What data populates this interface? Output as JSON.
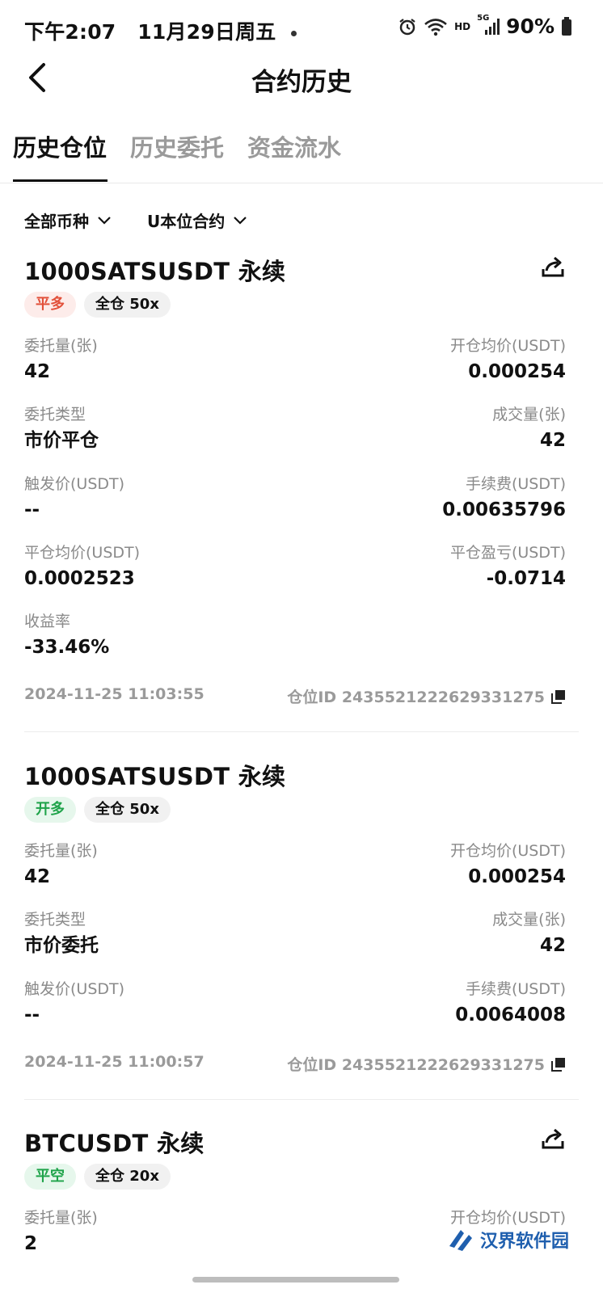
{
  "status": {
    "time": "下午2:07",
    "date": "11月29日周五",
    "hd": "HD",
    "network": "5G",
    "battery": "90%"
  },
  "header": {
    "title": "合约历史"
  },
  "tabs": [
    {
      "label": "历史仓位"
    },
    {
      "label": "历史委托"
    },
    {
      "label": "资金流水"
    }
  ],
  "filters": {
    "coin": "全部币种",
    "contract": "U本位合约"
  },
  "cards": [
    {
      "title": "1000SATSUSDT 永续",
      "tag_side": "平多",
      "tag_margin": "全仓 50x",
      "fields": [
        {
          "label": "委托量(张)",
          "value": "42"
        },
        {
          "label": "开仓均价(USDT)",
          "value": "0.000254"
        },
        {
          "label": "委托类型",
          "value": "市价平仓"
        },
        {
          "label": "成交量(张)",
          "value": "42"
        },
        {
          "label": "触发价(USDT)",
          "value": "--"
        },
        {
          "label": "手续费(USDT)",
          "value": "0.00635796"
        },
        {
          "label": "平仓均价(USDT)",
          "value": "0.0002523"
        },
        {
          "label": "平仓盈亏(USDT)",
          "value": "-0.0714"
        },
        {
          "label": "收益率",
          "value": "-33.46%"
        }
      ],
      "timestamp": "2024-11-25 11:03:55",
      "position_id": "仓位ID 2435521222629331275"
    },
    {
      "title": "1000SATSUSDT 永续",
      "tag_side": "开多",
      "tag_margin": "全仓 50x",
      "fields": [
        {
          "label": "委托量(张)",
          "value": "42"
        },
        {
          "label": "开仓均价(USDT)",
          "value": "0.000254"
        },
        {
          "label": "委托类型",
          "value": "市价委托"
        },
        {
          "label": "成交量(张)",
          "value": "42"
        },
        {
          "label": "触发价(USDT)",
          "value": "--"
        },
        {
          "label": "手续费(USDT)",
          "value": "0.0064008"
        }
      ],
      "timestamp": "2024-11-25 11:00:57",
      "position_id": "仓位ID 2435521222629331275"
    },
    {
      "title": "BTCUSDT 永续",
      "tag_side": "平空",
      "tag_margin": "全仓 20x",
      "fields": [
        {
          "label": "委托量(张)",
          "value": "2"
        },
        {
          "label": "开仓均价(USDT)",
          "value": ""
        }
      ]
    }
  ],
  "watermark": "汉界软件园",
  "colors": {
    "sell": "#e2503a",
    "buy": "#1fa34a",
    "muted": "#8a8a8a"
  }
}
